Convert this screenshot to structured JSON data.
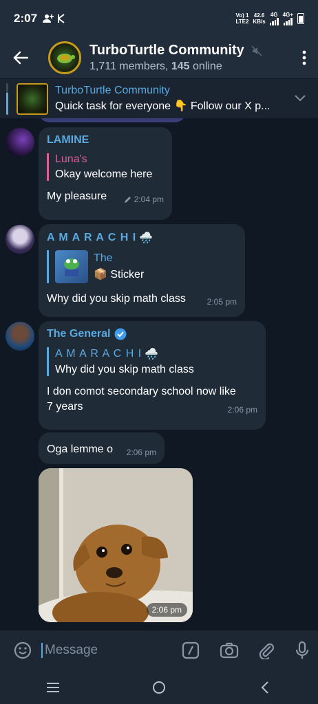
{
  "status": {
    "time": "2:07",
    "volte": "Vo) 1",
    "lte": "LTE2",
    "speed": "42.6",
    "speed_unit": "KB/s",
    "net1": "4G",
    "net2": "4G+"
  },
  "header": {
    "title": "TurboTurtle Community",
    "members": "1,711 members,",
    "online": "145",
    "online_suffix": " online"
  },
  "pinned": {
    "title": "TurboTurtle Community",
    "text": "Quick task for everyone 👇 Follow our X p..."
  },
  "messages": {
    "m1": {
      "sender": "LAMINE",
      "reply_name": "Luna's",
      "reply_text": "Okay welcome here",
      "text": "My pleasure",
      "time": "2:04 pm"
    },
    "m2": {
      "sender": "A M A R A C H I",
      "reply_name": "The",
      "reply_text": "📦 Sticker",
      "text": "Why did you skip math class",
      "time": "2:05 pm"
    },
    "m3": {
      "sender": "The General",
      "reply_name": "A M A R A C H I",
      "reply_text": "Why did you skip math class",
      "text1": "I don comot secondary school now like",
      "text2": "7 years",
      "time": "2:06 pm"
    },
    "m4": {
      "text": "Oga lemme o",
      "time": "2:06 pm"
    },
    "m5": {
      "time": "2:06 pm"
    }
  },
  "input": {
    "placeholder": "Message"
  },
  "colors": {
    "lamine": "#5aa9e0",
    "amarachi": "#5aa9e0",
    "luna": "#e05f95",
    "general": "#5aa9e0",
    "accent": "#5aa9e0"
  }
}
